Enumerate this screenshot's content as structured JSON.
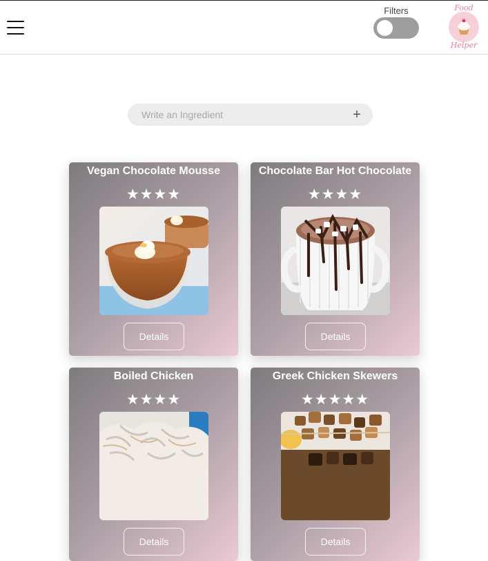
{
  "header": {
    "filters_label": "Filters",
    "filters_enabled": false,
    "logo_text_top": "Food",
    "logo_text_bottom": "Helper"
  },
  "search": {
    "placeholder": "Write an Ingredient",
    "value": "",
    "add_icon": "plus-icon"
  },
  "recipes": [
    {
      "title": "Vegan Chocolate Mousse",
      "stars": "★★★★",
      "rating": 4,
      "details_label": "Details"
    },
    {
      "title": "Chocolate Bar Hot Chocolate",
      "stars": "★★★★",
      "rating": 4,
      "details_label": "Details"
    },
    {
      "title": "Boiled Chicken",
      "stars": "★★★★",
      "rating": 4,
      "details_label": "Details"
    },
    {
      "title": "Greek Chicken Skewers",
      "stars": "★★★★★",
      "rating": 5,
      "details_label": "Details"
    }
  ],
  "colors": {
    "card_gradient_start": "#7e7b7e",
    "card_gradient_end": "#eac9d3",
    "logo_pink": "#e57c9a"
  }
}
